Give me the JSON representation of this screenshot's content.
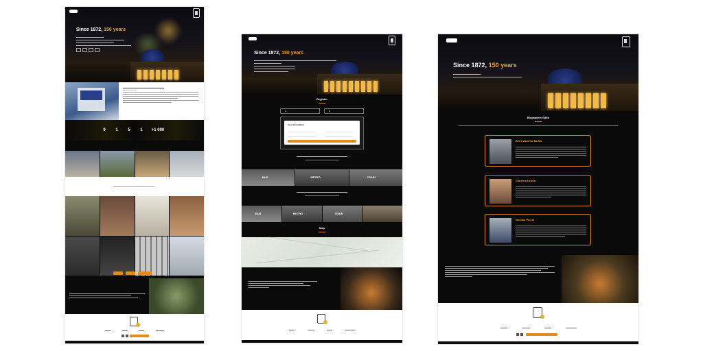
{
  "hero": {
    "title_prefix": "Since 1872,",
    "title_accent": "150 years"
  },
  "page2": {
    "register_title": "Register",
    "step1": "1",
    "step2": "2",
    "form_title": "Your information",
    "transport_bus": "BUS",
    "transport_metro": "METRO",
    "transport_train": "TRAIN",
    "map_title": "Map"
  },
  "page1": {
    "stats": [
      "9",
      "1",
      "5",
      "1",
      "+1 000"
    ]
  },
  "page3": {
    "section_title": "Biographer Edito",
    "people": [
      {
        "name": "Brice Andrew BLAN"
      },
      {
        "name": "Carmen Arroda"
      },
      {
        "name": "Nicolas Perret"
      }
    ]
  },
  "colors": {
    "accent": "#f0a030",
    "button": "#e08a20",
    "background": "#0a0a0a"
  }
}
